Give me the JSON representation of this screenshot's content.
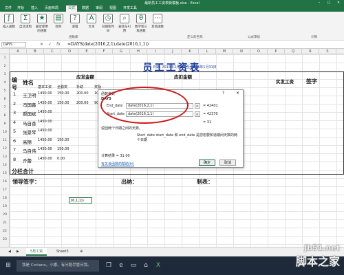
{
  "app": {
    "window_title": "最新员工工资表新模板.xlsx - Excel"
  },
  "ribbon_tabs": [
    "文件",
    "开始",
    "插入",
    "页面布局",
    "公式",
    "数据",
    "审阅",
    "视图",
    "开发工具"
  ],
  "ribbon_groups": {
    "function_library": "函数库",
    "buttons": [
      "插入函数",
      "自动求和",
      "最近使用的函数",
      "财务",
      "逻辑",
      "文本",
      "日期和时间",
      "查找与引用",
      "数学和三角函数",
      "其他函数"
    ],
    "defined_names": "定义的名称",
    "formula_auditing": "公式审核",
    "calculation": "计算"
  },
  "formula_bar": {
    "name_box": "DAYS",
    "formula": "=DAYS(date(2016,2,1),date(2016,1,1))"
  },
  "sheet": {
    "title": "员工工资表",
    "date_note": "日期: 2015年2月1日 至 2015年1月31日",
    "headers": {
      "no": "编号",
      "name": "姓名",
      "should_pay": "应发金额",
      "deduct": "应扣金额",
      "actual": "实发工资",
      "sign": "签字"
    },
    "sub_headers": [
      "基本工资",
      "全勤奖",
      "补助",
      "奖励"
    ],
    "rows": [
      {
        "no": "1",
        "name": "王卫明",
        "v": [
          "1450.00",
          "150.00",
          "200.00",
          "100.00"
        ]
      },
      {
        "no": "2",
        "name": "冯国鑫",
        "v": [
          "1450.00",
          "150.00",
          "200.00",
          "900.00"
        ]
      },
      {
        "no": "3",
        "name": "郝国斌",
        "v": [
          "1450.00",
          "",
          "",
          ""
        ]
      },
      {
        "no": "4",
        "name": "马自香",
        "v": [
          "1450.00",
          "",
          "",
          ""
        ]
      },
      {
        "no": "5",
        "name": "张景琴",
        "v": [
          "1450.00",
          "",
          "",
          ""
        ]
      },
      {
        "no": "6",
        "name": "高丽",
        "v": [
          "1450.00",
          "150.00",
          "",
          ""
        ]
      },
      {
        "no": "7",
        "name": "马自伟",
        "v": [
          "1450.00",
          "150.00",
          "",
          ""
        ]
      },
      {
        "no": "8",
        "name": "齐蕾",
        "v": [
          "1450.00",
          "0.00",
          "",
          ""
        ]
      }
    ],
    "subtotal": "分栏合计",
    "footer": {
      "leader": "领导签字：",
      "cashier": "出纳：",
      "maker": "制表："
    },
    "cell_b21": "16,1,1))"
  },
  "dialog": {
    "title": "函数参数",
    "func_name": "DAYS",
    "arg1_label": "End_date",
    "arg1_value": "date(2016,2,1)",
    "arg1_result": "= 42401",
    "arg2_label": "Start_date",
    "arg2_value": "date(2016,1,1)",
    "arg2_result": "= 42370",
    "total_result": "= 31",
    "description": "返回两个日期之间的天数。",
    "arg_help": "Start_date   start_date 和 end_date 是您想要知道期间天数的两个日期",
    "calc_result": "计算结果 = 31.00",
    "help_link": "有关该函数的帮助(H)",
    "ok": "确定",
    "cancel": "取消"
  },
  "sheet_tabs": [
    "5月工资",
    "Sheet3"
  ],
  "taskbar": {
    "search": "我是 Cortana，小娜。有问题尽管问我。"
  },
  "watermark": {
    "line1": "jb51.net",
    "line2": "脚本之家"
  },
  "colors": {
    "excel_green": "#217346",
    "title_blue": "#1a3a9a",
    "annotation_red": "#d01818"
  }
}
